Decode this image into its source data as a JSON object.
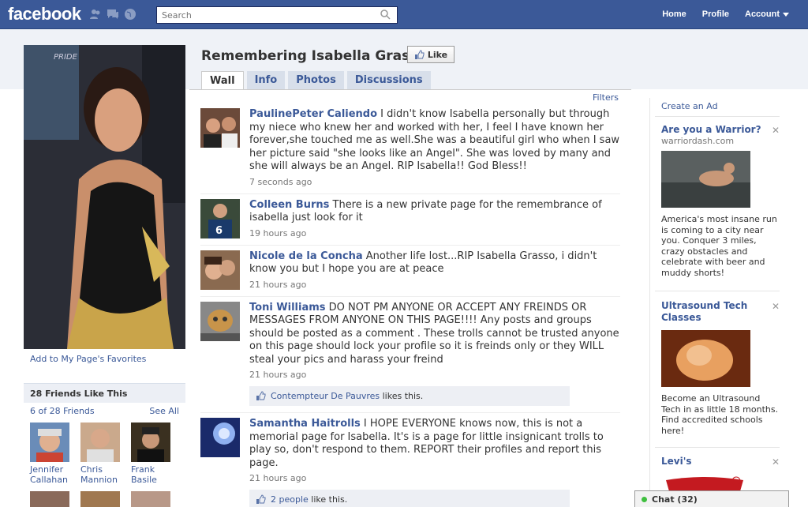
{
  "topbar": {
    "logo": "facebook",
    "search_placeholder": "Search",
    "nav": [
      "Home",
      "Profile",
      "Account"
    ]
  },
  "page": {
    "title": "Remembering Isabella Grasso",
    "like_button": "Like",
    "tabs": [
      "Wall",
      "Info",
      "Photos",
      "Discussions"
    ],
    "filters": "Filters"
  },
  "left": {
    "favorites_link": "Add to My Page's Favorites",
    "friends_heading": "28 Friends Like This",
    "friends_count": "6 of 28 Friends",
    "see_all": "See All",
    "friends": [
      {
        "first": "Jennifer",
        "last": "Callahan"
      },
      {
        "first": "Chris",
        "last": "Mannion"
      },
      {
        "first": "Frank",
        "last": "Basile"
      }
    ]
  },
  "feed": [
    {
      "author": "PaulinePeter Caliendo",
      "text": " I didn't know Isabella personally but through my niece who knew her and worked with her, I feel I have known her forever,she touched me as well.She was a beautiful girl who when I saw her picture said \"she looks like an Angel\". She was loved by many and she will always be an Angel. RIP Isabella!! God Bless!!",
      "time": "7 seconds ago"
    },
    {
      "author": "Colleen Burns",
      "text": " There is a new private page for the remembrance of isabella just look for it",
      "time": "19 hours ago"
    },
    {
      "author": "Nicole de la Concha",
      "text": " Another life lost...RIP Isabella Grasso, i didn't know you but I hope you are at peace",
      "time": "21 hours ago"
    },
    {
      "author": "Toni Williams",
      "text": " DO NOT PM ANYONE OR ACCEPT ANY FREINDS OR MESSAGES FROM ANYONE ON THIS PAGE!!!! Any posts and groups should be posted as a comment . These trolls cannot be trusted anyone on this page should lock your profile so it is freinds only or they WILL steal your pics and harass your freind",
      "time": "21 hours ago",
      "likes_who": "Contempteur De Pauvres",
      "likes_suffix": " likes this."
    },
    {
      "author": "Samantha Haitrolls",
      "text": " I HOPE EVERYONE knows now, this is not a memorial page for Isabella. It's is a page for little insignicant trolls to play so, don't respond to them. REPORT their profiles and report this page.",
      "time": "21 hours ago",
      "likes_who": "2 people",
      "likes_suffix": " like this."
    }
  ],
  "right": {
    "create_ad": "Create an Ad",
    "ads": [
      {
        "title": "Are you a Warrior?",
        "domain": "warriordash.com",
        "body": "America's most insane run is coming to a city near you. Conquer 3 miles, crazy obstacles and celebrate with beer and muddy shorts!"
      },
      {
        "title": "Ultrasound Tech Classes",
        "body": "Become an Ultrasound Tech in as little 18 months. Find accredited schools here!"
      },
      {
        "title": "Levi's"
      }
    ]
  },
  "chat": {
    "label": "Chat (32)"
  },
  "colors": {
    "brand": "#3b5998",
    "link": "#3b5998",
    "band": "#eff2f7"
  }
}
